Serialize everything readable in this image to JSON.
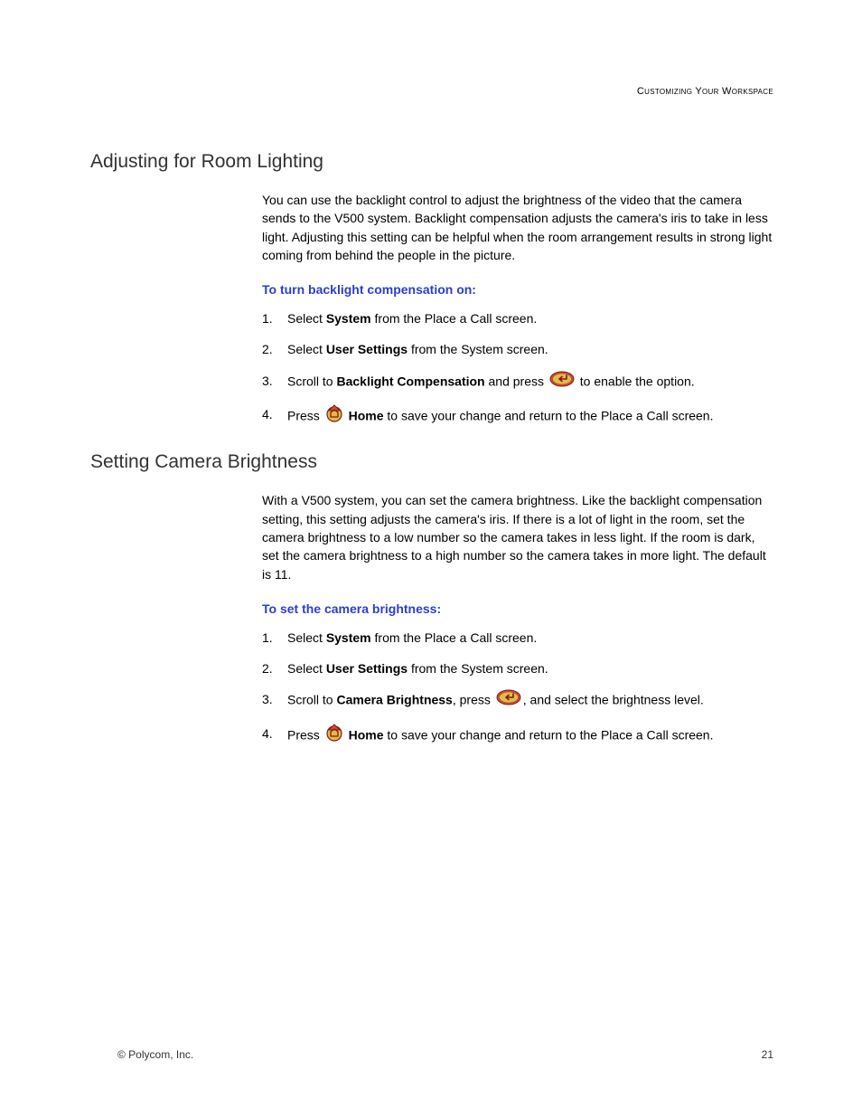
{
  "header": {
    "section_label": "Customizing Your Workspace"
  },
  "section1": {
    "heading": "Adjusting for Room Lighting",
    "intro": "You can use the backlight control to adjust the brightness of the video that the camera sends to the V500 system. Backlight compensation adjusts the camera's iris to take in less light. Adjusting this setting can be helpful when the room arrangement results in strong light coming from behind the people in the picture.",
    "subheading": "To turn backlight compensation on:",
    "steps": {
      "s1_a": "Select ",
      "s1_b": "System",
      "s1_c": " from the Place a Call screen.",
      "s2_a": "Select ",
      "s2_b": "User Settings",
      "s2_c": " from the System screen.",
      "s3_a": "Scroll to ",
      "s3_b": "Backlight Compensation",
      "s3_c": " and press ",
      "s3_d": " to enable the option.",
      "s4_a": "Press ",
      "s4_b": "Home",
      "s4_c": " to save your change and return to the Place a Call screen."
    }
  },
  "section2": {
    "heading": "Setting Camera Brightness",
    "intro": "With a V500 system, you can set the camera brightness. Like the backlight compensation setting, this setting adjusts the camera's iris. If there is a lot of light in the room, set the camera brightness to a low number so the camera takes in less light. If the room is dark, set the camera brightness to a high number so the camera takes in more light. The default is 11.",
    "subheading": "To set the camera brightness:",
    "steps": {
      "s1_a": "Select ",
      "s1_b": "System",
      "s1_c": " from the Place a Call screen.",
      "s2_a": "Select ",
      "s2_b": "User Settings",
      "s2_c": " from the System screen.",
      "s3_a": "Scroll to ",
      "s3_b": "Camera Brightness",
      "s3_c": ", press ",
      "s3_d": ", and select the brightness level.",
      "s4_a": "Press ",
      "s4_b": "Home",
      "s4_c": " to save your change and return to the Place a Call screen."
    }
  },
  "footer": {
    "copyright": "© Polycom, Inc.",
    "page": "21"
  },
  "icons": {
    "enter": "enter-icon",
    "home": "home-icon"
  }
}
